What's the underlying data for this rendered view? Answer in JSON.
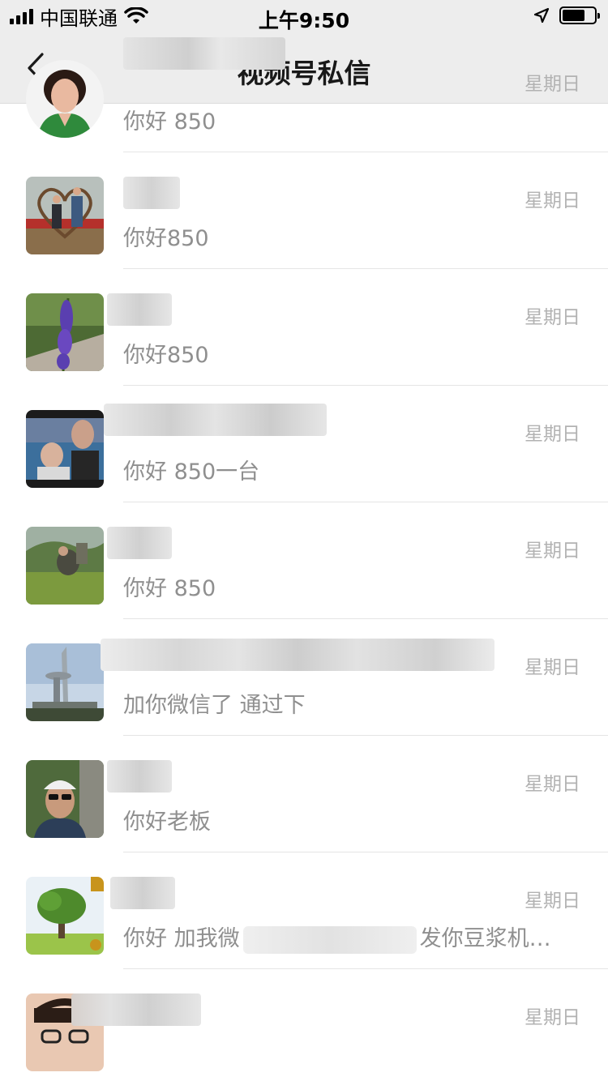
{
  "status_bar": {
    "carrier": "中国联通",
    "time": "上午9:50",
    "battery_level": 0.7
  },
  "nav": {
    "title": "视频号私信"
  },
  "conversations": [
    {
      "time": "星期日",
      "preview": "你好 850"
    },
    {
      "time": "星期日",
      "preview": "你好850"
    },
    {
      "time": "星期日",
      "preview": "你好850"
    },
    {
      "time": "星期日",
      "preview": "你好 850一台"
    },
    {
      "time": "星期日",
      "preview": "你好 850"
    },
    {
      "time": "星期日",
      "preview": "加你微信了 通过下"
    },
    {
      "time": "星期日",
      "preview": "你好老板"
    },
    {
      "time": "星期日",
      "preview_start": "你好 加我微",
      "preview_end": "发你豆浆机…"
    },
    {
      "time": "星期日",
      "preview": ""
    }
  ],
  "colors": {
    "bar_bg": "#ededed",
    "time_text": "#b2b2b2",
    "preview_text": "#8f8f8f"
  }
}
